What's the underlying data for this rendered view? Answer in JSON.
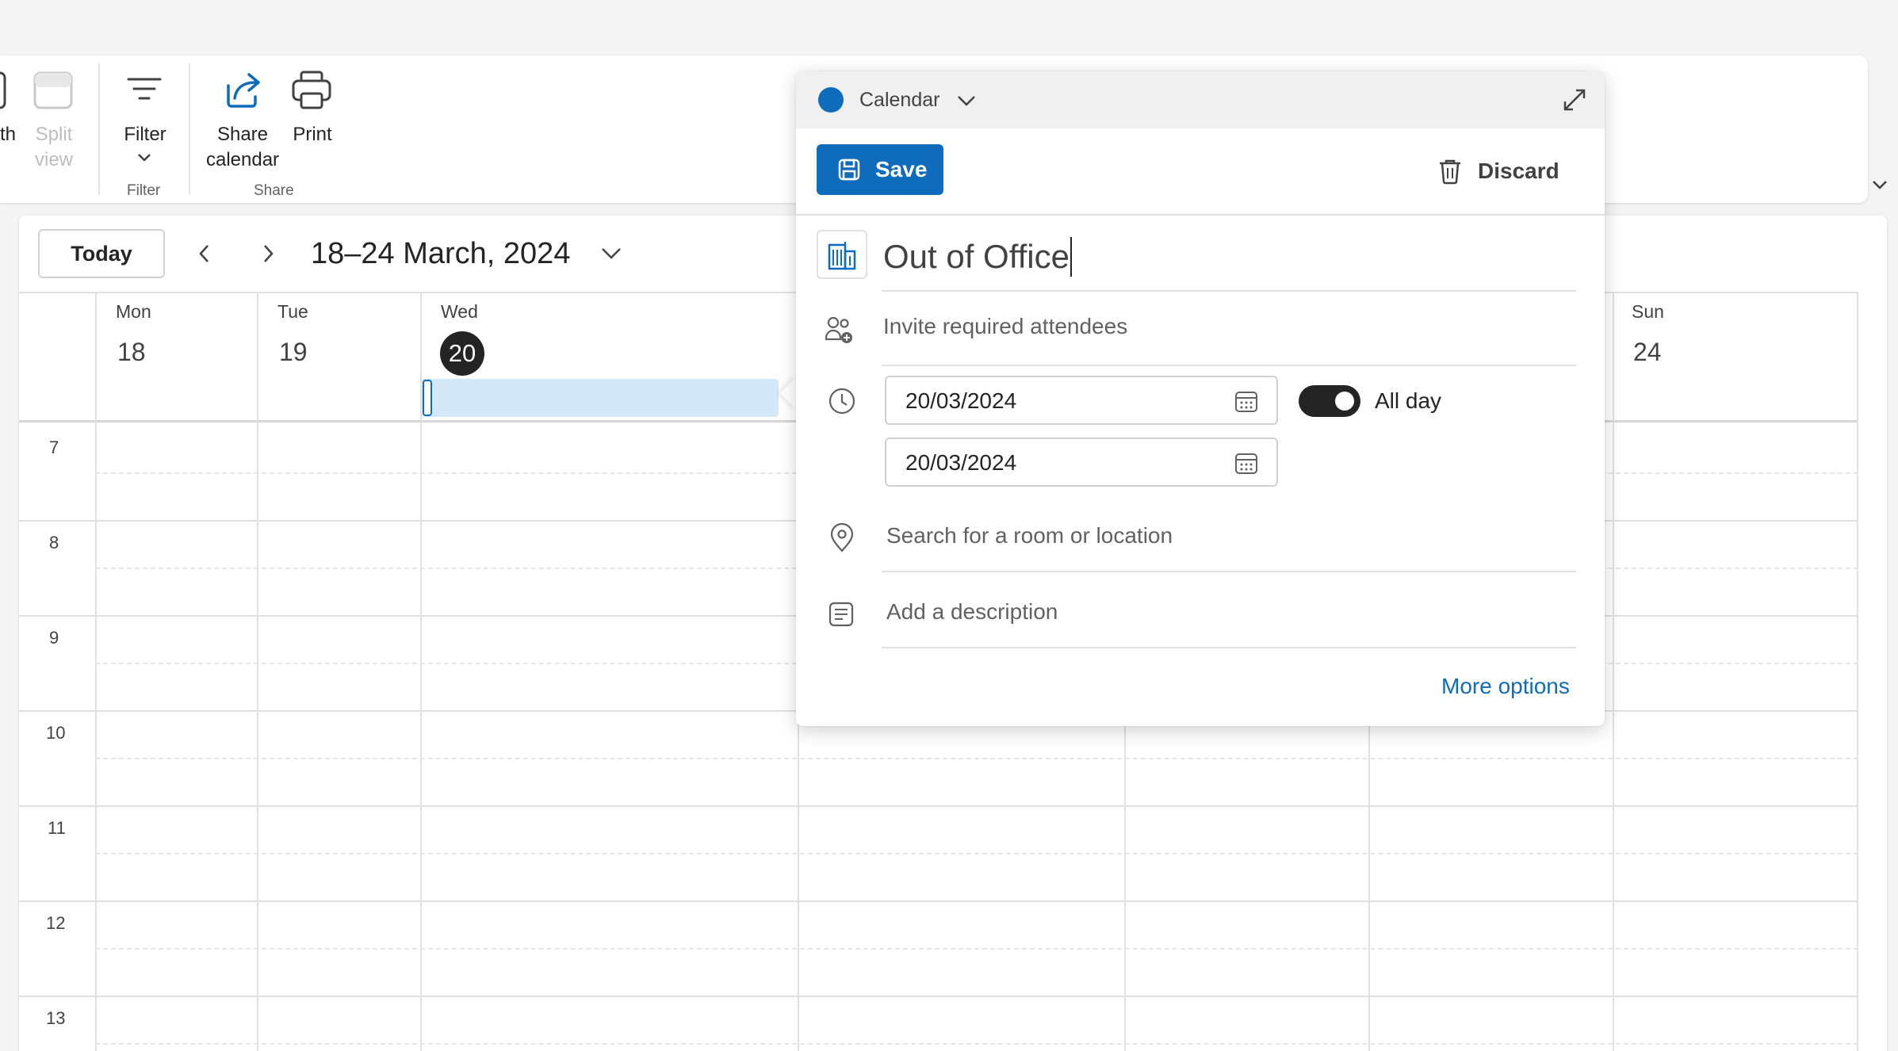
{
  "ribbon": {
    "month_partial": "th",
    "split_view": [
      "Split",
      "view"
    ],
    "filter": "Filter",
    "filter_group": "Filter",
    "share_calendar": [
      "Share",
      "calendar"
    ],
    "print": "Print",
    "share_group": "Share"
  },
  "toolbar": {
    "today": "Today",
    "date_range": "18–24 March, 2024"
  },
  "week": {
    "days": [
      {
        "name": "Mon",
        "num": "18"
      },
      {
        "name": "Tue",
        "num": "19"
      },
      {
        "name": "Wed",
        "num": "20"
      },
      {
        "name": "Sun",
        "num": "24"
      }
    ],
    "hours": [
      "7",
      "8",
      "9",
      "10",
      "11",
      "12",
      "13"
    ]
  },
  "event_form": {
    "calendar_label": "Calendar",
    "calendar_color": "#0f6cbd",
    "save": "Save",
    "discard": "Discard",
    "title": "Out of Office",
    "attendees_placeholder": "Invite required attendees",
    "start_date": "20/03/2024",
    "end_date": "20/03/2024",
    "all_day_label": "All day",
    "all_day_on": true,
    "location_placeholder": "Search for a room or location",
    "description_placeholder": "Add a description",
    "more_options": "More options"
  },
  "colors": {
    "accent": "#0f6cbd",
    "selection": "#d4e8f7",
    "today_circle": "#242424"
  }
}
